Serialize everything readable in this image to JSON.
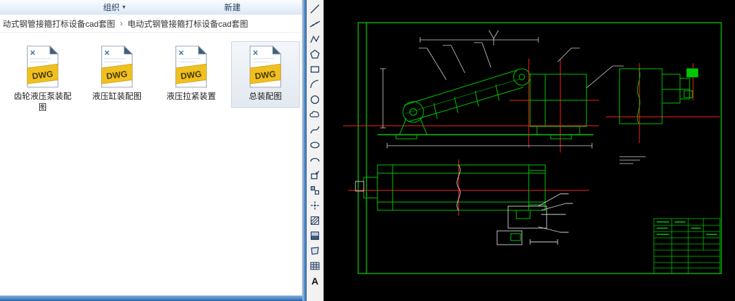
{
  "colors": {
    "cad_background": "#000000",
    "cad_green": "#00c800",
    "cad_red": "#ff2020",
    "cad_white": "#d8d8d8",
    "selection_bg": "#e3e9f1",
    "frame_blue": "#5b93cc",
    "dwg_yellow": "#f0c020"
  },
  "explorer": {
    "command_bar": {
      "organize_label": "组织",
      "new_label": "新建",
      "chevron": "▾"
    },
    "breadcrumb": {
      "segment1": "动式钢管接箍打标设备cad套图",
      "separator": "›",
      "segment2": "电动式钢管接箍打标设备cad套图"
    },
    "files": [
      {
        "name": "齿轮液压泵装配图",
        "badge": "DWG"
      },
      {
        "name": "液压缸装配图",
        "badge": "DWG"
      },
      {
        "name": "液压拉紧装置",
        "badge": "DWG"
      },
      {
        "name": "总装配图",
        "badge": "DWG"
      }
    ],
    "selected_file": "总装配图"
  },
  "cad": {
    "mtext_label": "A",
    "toolbar_icons": [
      "line-icon",
      "construction-line-icon",
      "polyline-icon",
      "polygon-icon",
      "rectangle-icon",
      "arc-icon",
      "circle-icon",
      "revcloud-icon",
      "spline-icon",
      "ellipse-icon",
      "ellipse-arc-icon",
      "insert-block-icon",
      "make-block-icon",
      "point-icon",
      "hatch-icon",
      "gradient-icon",
      "region-icon",
      "table-icon",
      "mtext-icon"
    ]
  }
}
